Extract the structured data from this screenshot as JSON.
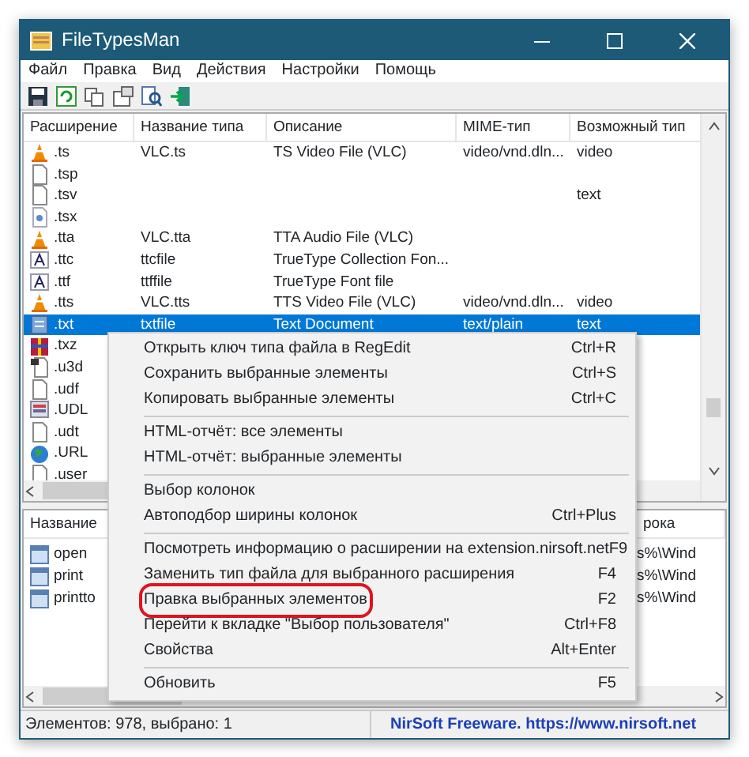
{
  "window": {
    "title": "FileTypesMan"
  },
  "menu_bar": [
    "Файл",
    "Правка",
    "Вид",
    "Действия",
    "Настройки",
    "Помощь"
  ],
  "table": {
    "columns": [
      "Расширение",
      "Название типа",
      "Описание",
      "MIME-тип",
      "Возможный тип"
    ],
    "rows": [
      {
        "kind": "vlc",
        "selected": false,
        "extension": ".ts",
        "type_name": "VLC.ts",
        "description": "TS Video File (VLC)",
        "mime_type": "video/vnd.dln...",
        "possible_type": "video"
      },
      {
        "kind": "blank",
        "selected": false,
        "extension": ".tsp"
      },
      {
        "kind": "blank",
        "selected": false,
        "extension": ".tsv",
        "possible_type": "text"
      },
      {
        "kind": "script",
        "selected": false,
        "extension": ".tsx"
      },
      {
        "kind": "vlc",
        "selected": false,
        "extension": ".tta",
        "type_name": "VLC.tta",
        "description": "TTA Audio File (VLC)"
      },
      {
        "kind": "font",
        "selected": false,
        "extension": ".ttc",
        "type_name": "ttcfile",
        "description": "TrueType Collection Fon..."
      },
      {
        "kind": "font",
        "selected": false,
        "extension": ".ttf",
        "type_name": "ttffile",
        "description": "TrueType Font file"
      },
      {
        "kind": "vlc",
        "selected": false,
        "extension": ".tts",
        "type_name": "VLC.tts",
        "description": "TTS Video File (VLC)",
        "mime_type": "video/vnd.dln...",
        "possible_type": "video"
      },
      {
        "kind": "text",
        "selected": true,
        "extension": ".txt",
        "type_name": "txtfile",
        "description": "Text Document",
        "mime_type": "text/plain",
        "possible_type": "text"
      },
      {
        "kind": "archive",
        "selected": false,
        "extension": ".txz"
      },
      {
        "kind": "model",
        "selected": false,
        "extension": ".u3d"
      },
      {
        "kind": "blank",
        "selected": false,
        "extension": ".udf"
      },
      {
        "kind": "udl",
        "selected": false,
        "extension": ".UDL"
      },
      {
        "kind": "blank",
        "selected": false,
        "extension": ".udt"
      },
      {
        "kind": "globe",
        "selected": false,
        "extension": ".URL"
      },
      {
        "kind": "blank",
        "selected": false,
        "extension": ".user"
      }
    ]
  },
  "actions_pane": {
    "columns": [
      "Название",
      "рока"
    ],
    "rows": [
      {
        "name": "open",
        "column_2": "s%\\Wind"
      },
      {
        "name": "print",
        "column_2": "s%\\Wind"
      },
      {
        "name": "printto",
        "column_2": "s%\\Wind"
      }
    ]
  },
  "context_menu": {
    "groups": [
      [
        {
          "label": "Открыть ключ типа файла в RegEdit",
          "shortcut": "Ctrl+R",
          "circled": false
        },
        {
          "label": "Сохранить выбранные элементы",
          "shortcut": "Ctrl+S",
          "circled": false
        },
        {
          "label": "Копировать выбранные элементы",
          "shortcut": "Ctrl+C",
          "circled": false
        }
      ],
      [
        {
          "label": "HTML-отчёт: все элементы",
          "circled": false
        },
        {
          "label": "HTML-отчёт: выбранные элементы",
          "circled": false
        }
      ],
      [
        {
          "label": "Выбор колонок",
          "circled": false
        },
        {
          "label": "Автоподбор ширины колонок",
          "shortcut": "Ctrl+Plus",
          "circled": false
        }
      ],
      [
        {
          "label": "Посмотреть информацию о расширении на extension.nirsoft.net",
          "shortcut": "F9",
          "circled": false
        },
        {
          "label": "Заменить тип файла для выбранного расширения",
          "shortcut": "F4",
          "circled": false
        },
        {
          "label": "Правка выбранных элементов",
          "shortcut": "F2",
          "circled": true
        },
        {
          "label": "Перейти к вкладке \"Выбор пользователя\"",
          "shortcut": "Ctrl+F8",
          "circled": false
        },
        {
          "label": "Свойства",
          "shortcut": "Alt+Enter",
          "circled": false
        }
      ],
      [
        {
          "label": "Обновить",
          "shortcut": "F5",
          "circled": false
        }
      ]
    ]
  },
  "status_bar": {
    "count": "Элементов: 978, выбрано: 1",
    "link": "NirSoft Freeware. https://www.nirsoft.net"
  }
}
